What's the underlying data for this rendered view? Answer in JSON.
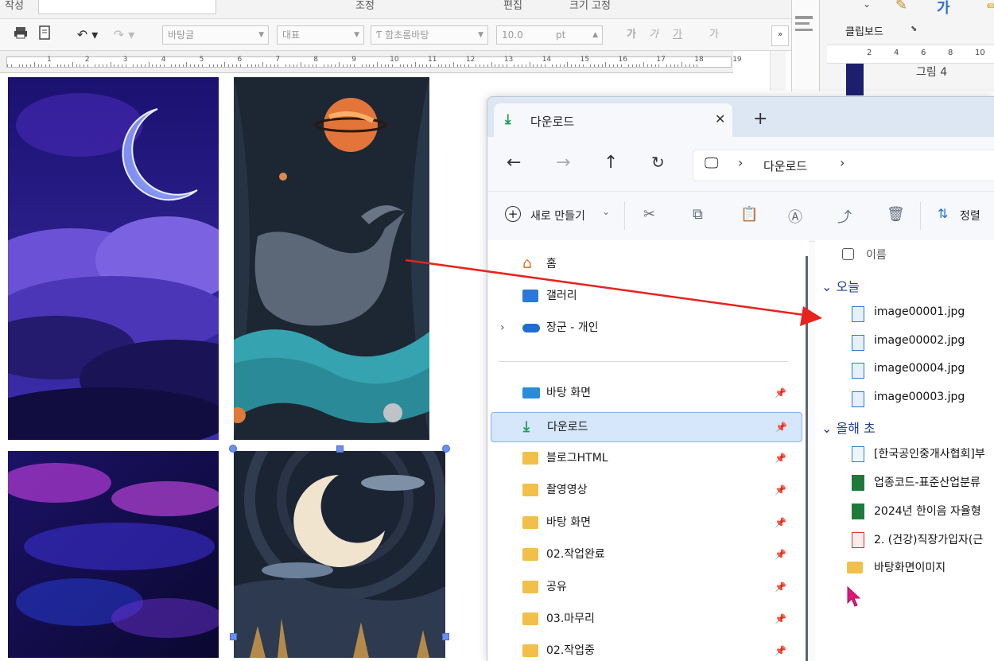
{
  "hwp": {
    "top_fragments": [
      "작성",
      "조정",
      "편집",
      "크기 고정"
    ],
    "font_style": "바탕글",
    "style_rep": "대표",
    "font_name": "함초롬바탕",
    "font_size": "10.0",
    "font_unit": "pt",
    "format_buttons": [
      "가",
      "가",
      "가",
      "가"
    ],
    "ruler_numbers": [
      "1",
      "2",
      "3",
      "4",
      "5",
      "6",
      "7",
      "8",
      "9",
      "10",
      "11",
      "12",
      "13",
      "14",
      "15",
      "16",
      "17",
      "18",
      "19"
    ]
  },
  "ribbon": {
    "clipboard_label": "클립보드",
    "ruler_numbers": [
      "2",
      "4",
      "6",
      "8",
      "10"
    ],
    "figure_label": "그림 4"
  },
  "explorer": {
    "tab_title": "다운로드",
    "breadcrumb": [
      "다운로드"
    ],
    "new_button": "새로 만들기",
    "sort_button": "정렬",
    "nav_top": [
      {
        "label": "홈",
        "icon": "home-icon"
      },
      {
        "label": "갤러리",
        "icon": "gallery-icon"
      },
      {
        "label": "장군 - 개인",
        "icon": "onedrive-icon"
      }
    ],
    "nav_pinned": [
      {
        "label": "바탕 화면",
        "icon": "desktop-icon"
      },
      {
        "label": "다운로드",
        "icon": "download-icon",
        "selected": true
      },
      {
        "label": "블로그HTML",
        "icon": "folder-icon"
      },
      {
        "label": "촬영영상",
        "icon": "folder-icon"
      },
      {
        "label": "바탕 화면",
        "icon": "folder-icon"
      },
      {
        "label": "02.작업완료",
        "icon": "folder-icon"
      },
      {
        "label": "공유",
        "icon": "folder-icon"
      },
      {
        "label": "03.마무리",
        "icon": "folder-icon"
      },
      {
        "label": "02.작업중",
        "icon": "folder-icon"
      }
    ],
    "column_header": "이름",
    "groups": [
      {
        "title": "오늘",
        "files": [
          "image00001.jpg",
          "image00002.jpg",
          "image00004.jpg",
          "image00003.jpg"
        ]
      },
      {
        "title": "올해 초",
        "files": [
          "[한국공인중개사협회]부",
          "업종코드-표준산업분류",
          "2024년 한이음 자율형",
          "2. (건강)직장가입자(근",
          "바탕화면이미지"
        ]
      }
    ]
  },
  "colors": {
    "arrow": "#e8221c",
    "selection": "#6b8ef0",
    "accent": "#1f6fd0"
  }
}
